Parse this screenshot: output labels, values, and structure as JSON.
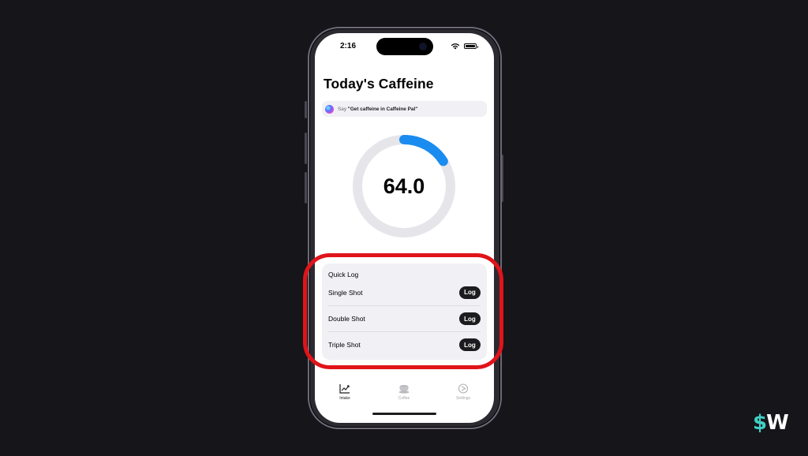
{
  "status_bar": {
    "time": "2:16"
  },
  "screen": {
    "title": "Today's Caffeine",
    "siri_tip": {
      "prefix": "Say ",
      "phrase": "\"Get caffeine in Caffeine Pal\""
    },
    "gauge": {
      "value": "64.0",
      "progress_fraction": 0.16,
      "accent_color": "#1a8cf0",
      "track_color": "#e5e5ea"
    },
    "quick_log": {
      "title": "Quick Log",
      "items": [
        {
          "label": "Single Shot",
          "button": "Log"
        },
        {
          "label": "Double Shot",
          "button": "Log"
        },
        {
          "label": "Triple Shot",
          "button": "Log"
        }
      ]
    },
    "tabs": [
      {
        "label": "Intake",
        "icon": "chart-line-icon",
        "active": true
      },
      {
        "label": "Coffee",
        "icon": "coffee-cup-icon",
        "active": false
      },
      {
        "label": "Settings",
        "icon": "settings-icon",
        "active": false
      }
    ]
  },
  "annotation": {
    "highlight_color": "#e0141a"
  },
  "brand": {
    "logo": "$W"
  }
}
